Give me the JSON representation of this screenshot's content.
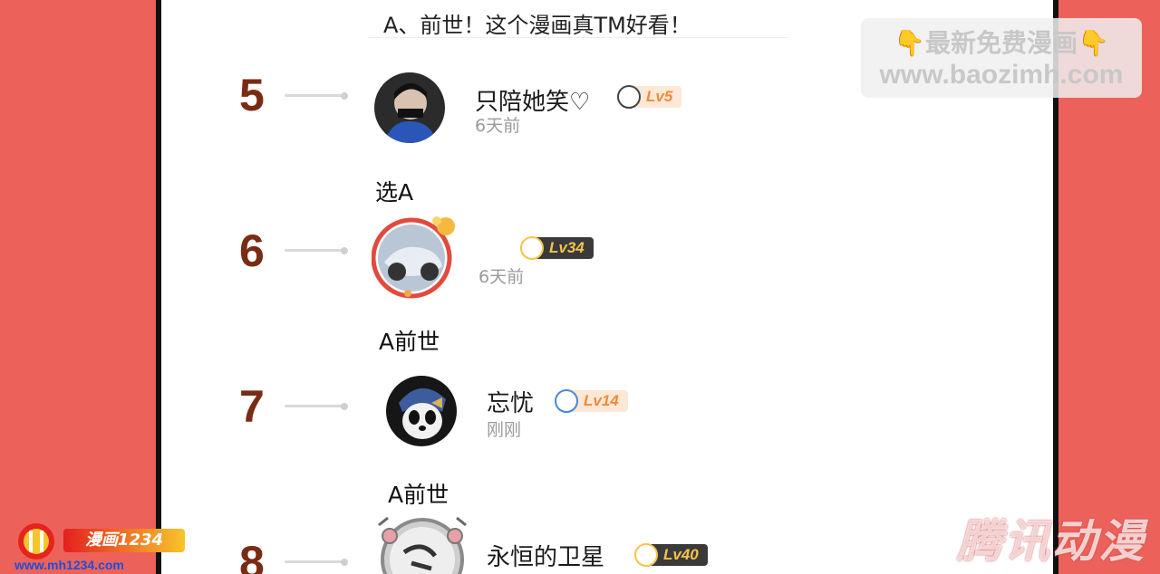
{
  "top_comment": "A、前世！这个漫画真TM好看！",
  "watermark": {
    "line1": "👇最新免费漫画👇",
    "line2": "www.baozimh.com"
  },
  "entries": [
    {
      "rank": "5",
      "username": "只陪她笑♡",
      "level": "Lv5",
      "time": "6天前",
      "comment": "选A"
    },
    {
      "rank": "6",
      "username": "",
      "level": "Lv34",
      "time": "6天前",
      "comment": "A前世"
    },
    {
      "rank": "7",
      "username": "忘忧",
      "level": "Lv14",
      "time": "刚刚",
      "comment": "A前世"
    },
    {
      "rank": "8",
      "username": "永恒的卫星",
      "level": "Lv40",
      "time": "",
      "comment": ""
    }
  ],
  "logo_left": {
    "name": "漫画1234",
    "url": "www.mh1234.com"
  },
  "logo_right": "腾讯动漫",
  "colors": {
    "background": "#ec625a",
    "rank": "#7a2b14",
    "panel": "#ffffff"
  }
}
